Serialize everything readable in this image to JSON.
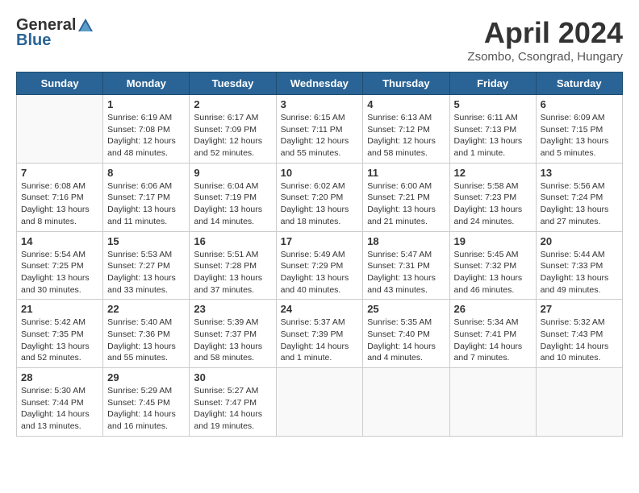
{
  "header": {
    "logo_general": "General",
    "logo_blue": "Blue",
    "month_title": "April 2024",
    "location": "Zsombo, Csongrad, Hungary"
  },
  "days_of_week": [
    "Sunday",
    "Monday",
    "Tuesday",
    "Wednesday",
    "Thursday",
    "Friday",
    "Saturday"
  ],
  "weeks": [
    [
      {
        "day": "",
        "info": ""
      },
      {
        "day": "1",
        "info": "Sunrise: 6:19 AM\nSunset: 7:08 PM\nDaylight: 12 hours\nand 48 minutes."
      },
      {
        "day": "2",
        "info": "Sunrise: 6:17 AM\nSunset: 7:09 PM\nDaylight: 12 hours\nand 52 minutes."
      },
      {
        "day": "3",
        "info": "Sunrise: 6:15 AM\nSunset: 7:11 PM\nDaylight: 12 hours\nand 55 minutes."
      },
      {
        "day": "4",
        "info": "Sunrise: 6:13 AM\nSunset: 7:12 PM\nDaylight: 12 hours\nand 58 minutes."
      },
      {
        "day": "5",
        "info": "Sunrise: 6:11 AM\nSunset: 7:13 PM\nDaylight: 13 hours\nand 1 minute."
      },
      {
        "day": "6",
        "info": "Sunrise: 6:09 AM\nSunset: 7:15 PM\nDaylight: 13 hours\nand 5 minutes."
      }
    ],
    [
      {
        "day": "7",
        "info": "Sunrise: 6:08 AM\nSunset: 7:16 PM\nDaylight: 13 hours\nand 8 minutes."
      },
      {
        "day": "8",
        "info": "Sunrise: 6:06 AM\nSunset: 7:17 PM\nDaylight: 13 hours\nand 11 minutes."
      },
      {
        "day": "9",
        "info": "Sunrise: 6:04 AM\nSunset: 7:19 PM\nDaylight: 13 hours\nand 14 minutes."
      },
      {
        "day": "10",
        "info": "Sunrise: 6:02 AM\nSunset: 7:20 PM\nDaylight: 13 hours\nand 18 minutes."
      },
      {
        "day": "11",
        "info": "Sunrise: 6:00 AM\nSunset: 7:21 PM\nDaylight: 13 hours\nand 21 minutes."
      },
      {
        "day": "12",
        "info": "Sunrise: 5:58 AM\nSunset: 7:23 PM\nDaylight: 13 hours\nand 24 minutes."
      },
      {
        "day": "13",
        "info": "Sunrise: 5:56 AM\nSunset: 7:24 PM\nDaylight: 13 hours\nand 27 minutes."
      }
    ],
    [
      {
        "day": "14",
        "info": "Sunrise: 5:54 AM\nSunset: 7:25 PM\nDaylight: 13 hours\nand 30 minutes."
      },
      {
        "day": "15",
        "info": "Sunrise: 5:53 AM\nSunset: 7:27 PM\nDaylight: 13 hours\nand 33 minutes."
      },
      {
        "day": "16",
        "info": "Sunrise: 5:51 AM\nSunset: 7:28 PM\nDaylight: 13 hours\nand 37 minutes."
      },
      {
        "day": "17",
        "info": "Sunrise: 5:49 AM\nSunset: 7:29 PM\nDaylight: 13 hours\nand 40 minutes."
      },
      {
        "day": "18",
        "info": "Sunrise: 5:47 AM\nSunset: 7:31 PM\nDaylight: 13 hours\nand 43 minutes."
      },
      {
        "day": "19",
        "info": "Sunrise: 5:45 AM\nSunset: 7:32 PM\nDaylight: 13 hours\nand 46 minutes."
      },
      {
        "day": "20",
        "info": "Sunrise: 5:44 AM\nSunset: 7:33 PM\nDaylight: 13 hours\nand 49 minutes."
      }
    ],
    [
      {
        "day": "21",
        "info": "Sunrise: 5:42 AM\nSunset: 7:35 PM\nDaylight: 13 hours\nand 52 minutes."
      },
      {
        "day": "22",
        "info": "Sunrise: 5:40 AM\nSunset: 7:36 PM\nDaylight: 13 hours\nand 55 minutes."
      },
      {
        "day": "23",
        "info": "Sunrise: 5:39 AM\nSunset: 7:37 PM\nDaylight: 13 hours\nand 58 minutes."
      },
      {
        "day": "24",
        "info": "Sunrise: 5:37 AM\nSunset: 7:39 PM\nDaylight: 14 hours\nand 1 minute."
      },
      {
        "day": "25",
        "info": "Sunrise: 5:35 AM\nSunset: 7:40 PM\nDaylight: 14 hours\nand 4 minutes."
      },
      {
        "day": "26",
        "info": "Sunrise: 5:34 AM\nSunset: 7:41 PM\nDaylight: 14 hours\nand 7 minutes."
      },
      {
        "day": "27",
        "info": "Sunrise: 5:32 AM\nSunset: 7:43 PM\nDaylight: 14 hours\nand 10 minutes."
      }
    ],
    [
      {
        "day": "28",
        "info": "Sunrise: 5:30 AM\nSunset: 7:44 PM\nDaylight: 14 hours\nand 13 minutes."
      },
      {
        "day": "29",
        "info": "Sunrise: 5:29 AM\nSunset: 7:45 PM\nDaylight: 14 hours\nand 16 minutes."
      },
      {
        "day": "30",
        "info": "Sunrise: 5:27 AM\nSunset: 7:47 PM\nDaylight: 14 hours\nand 19 minutes."
      },
      {
        "day": "",
        "info": ""
      },
      {
        "day": "",
        "info": ""
      },
      {
        "day": "",
        "info": ""
      },
      {
        "day": "",
        "info": ""
      }
    ]
  ]
}
